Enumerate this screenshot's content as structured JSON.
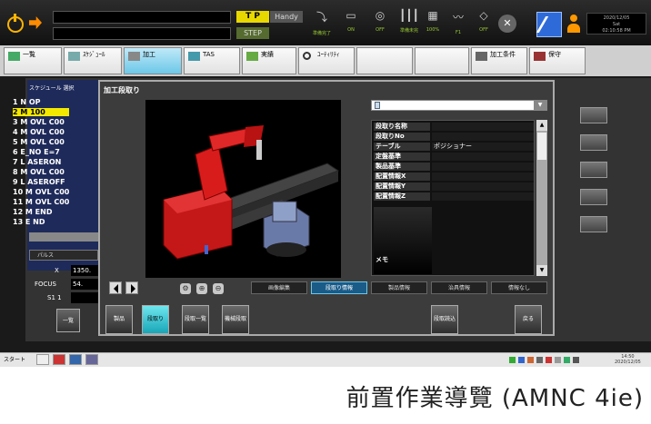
{
  "topbar": {
    "tp_label": "T P",
    "handy_label": "Handy",
    "step_label": "STEP",
    "status_icons": [
      {
        "name": "ready-icon",
        "label": "準備完了"
      },
      {
        "name": "on-icon",
        "label": "ON"
      },
      {
        "name": "off-icon",
        "label": "OFF"
      },
      {
        "name": "prep-icon",
        "label": "準備未完"
      },
      {
        "name": "percent-icon",
        "label": "100%"
      },
      {
        "name": "f1-icon",
        "label": "F1"
      },
      {
        "name": "off2-icon",
        "label": "OFF"
      }
    ],
    "clock": {
      "date": "2020/12/05",
      "day": "Sat",
      "time": "02:10:58 PM"
    }
  },
  "tabs": [
    {
      "label": "一覧",
      "icon": "list-icon"
    },
    {
      "label": "ｽｹｼﾞｭｰﾙ",
      "icon": "schedule-icon"
    },
    {
      "label": "加工",
      "icon": "machining-icon",
      "active": true
    },
    {
      "label": "TAS",
      "icon": "tas-icon"
    },
    {
      "label": "実績",
      "icon": "results-icon"
    },
    {
      "label": "ﾕｰﾃｨﾘﾃｨ",
      "icon": "search-icon"
    },
    {
      "label": "",
      "icon": ""
    },
    {
      "label": "",
      "icon": ""
    },
    {
      "label": "加工条件",
      "icon": "conditions-icon"
    },
    {
      "label": "保守",
      "icon": "maintenance-icon"
    }
  ],
  "schedule": {
    "title": "スケジュール 選択",
    "rows": [
      "1 N OP",
      "2 M 100",
      "3 M OVL C00",
      "4 M OVL C00",
      "5 M OVL C00",
      "6 E_NO E=7",
      "7 L ASERON",
      "8 M OVL C00",
      "9 L ASEROFF",
      "10 M OVL C00",
      "11 M OVL C00",
      "12 M END",
      "13 E ND"
    ],
    "selected_index": 1
  },
  "values": {
    "pulse_label": "パルス",
    "x_label": "X",
    "x_value": "1350.",
    "focus_label": "FOCUS",
    "focus_value": "54.",
    "s_label": "S1 1",
    "list_button": "一覧"
  },
  "dialog": {
    "title": "加工段取り",
    "info_rows": [
      {
        "key": "段取り名称",
        "value": ""
      },
      {
        "key": "段取りNo",
        "value": ""
      },
      {
        "key": "テーブル",
        "value": "ポジショナー"
      },
      {
        "key": "定盤基準",
        "value": ""
      },
      {
        "key": "製品基準",
        "value": ""
      },
      {
        "key": "配置情報X",
        "value": ""
      },
      {
        "key": "配置情報Y",
        "value": ""
      },
      {
        "key": "配置情報Z",
        "value": ""
      }
    ],
    "memo_label": "メモ",
    "subtabs": [
      "画像編集",
      "段取り情報",
      "製品情報",
      "治具情報",
      "情報なし"
    ],
    "active_subtab": 1,
    "buttons": [
      "製品",
      "段取り",
      "段取一覧",
      "機械段取",
      "段取読込",
      "戻る"
    ],
    "active_button": 1
  },
  "taskbar": {
    "start_label": "スタート",
    "time": "14:50",
    "date": "2020/12/05"
  },
  "caption": "前置作業導覽 (AMNC 4ie)",
  "colors": {
    "accent": "#6cc8e8",
    "selected_row": "#f3e800",
    "robot": "#d81c1c"
  }
}
